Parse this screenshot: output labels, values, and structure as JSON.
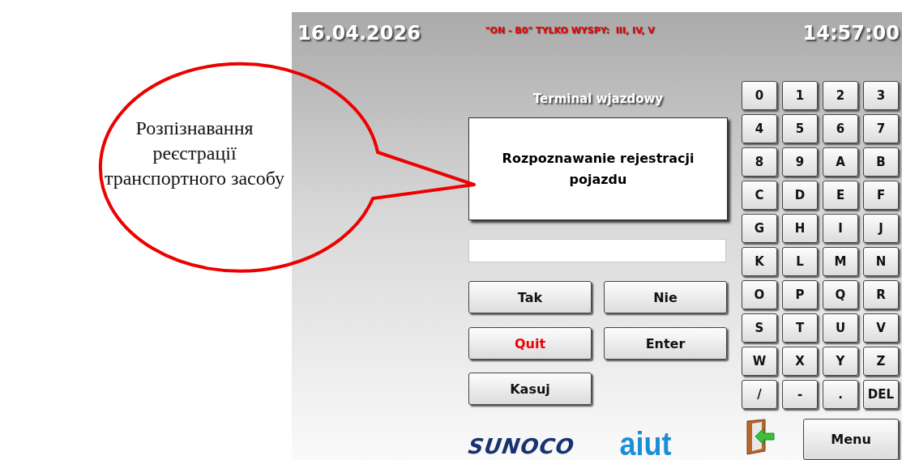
{
  "annotation": {
    "text": "Розпізнавання реєстрації транспортного засобу"
  },
  "header": {
    "date": "16.04.2026",
    "notice": "\"ON - B0\" TYLKO WYSPY:  III, IV, V",
    "time": "14:57:00"
  },
  "title": "Terminal wjazdowy",
  "message": "Rozpoznawanie rejestracji pojazdu",
  "actions": [
    {
      "label": "Tak",
      "kind": "normal"
    },
    {
      "label": "Nie",
      "kind": "normal"
    },
    {
      "label": "Quit",
      "kind": "danger"
    },
    {
      "label": "Enter",
      "kind": "normal"
    },
    {
      "label": "Kasuj",
      "kind": "normal"
    }
  ],
  "keys": [
    "0",
    "1",
    "2",
    "3",
    "4",
    "5",
    "6",
    "7",
    "8",
    "9",
    "A",
    "B",
    "C",
    "D",
    "E",
    "F",
    "G",
    "H",
    "I",
    "J",
    "K",
    "L",
    "M",
    "N",
    "O",
    "P",
    "Q",
    "R",
    "S",
    "T",
    "U",
    "V",
    "W",
    "X",
    "Y",
    "Z",
    "/",
    "-",
    ".",
    "DEL"
  ],
  "logos": [
    {
      "text": "SUNOCO",
      "kind": "sunoco"
    },
    {
      "text": "aiut",
      "kind": "aiut"
    }
  ],
  "menu_button": "Menu"
}
